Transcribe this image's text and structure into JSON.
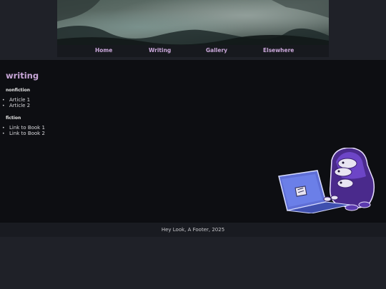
{
  "nav": {
    "items": [
      {
        "label": "Home"
      },
      {
        "label": "Writing"
      },
      {
        "label": "Gallery"
      },
      {
        "label": "Elsewhere"
      }
    ]
  },
  "main": {
    "title": "writing",
    "sections": [
      {
        "heading": "nonfiction",
        "items": [
          "Article 1",
          "Article 2"
        ]
      },
      {
        "heading": "fiction",
        "items": [
          "Link to Book 1",
          "Link to Book 2"
        ]
      }
    ]
  },
  "footer": {
    "text": "Hey Look, A Footer, 2025"
  },
  "colors": {
    "accent": "#c9a7d9",
    "page_background": "#1f2128",
    "content_background": "#0d0e12",
    "nav_background": "#17191e"
  },
  "icons": {
    "mascot": "purple-character-with-laptop-illustration"
  }
}
